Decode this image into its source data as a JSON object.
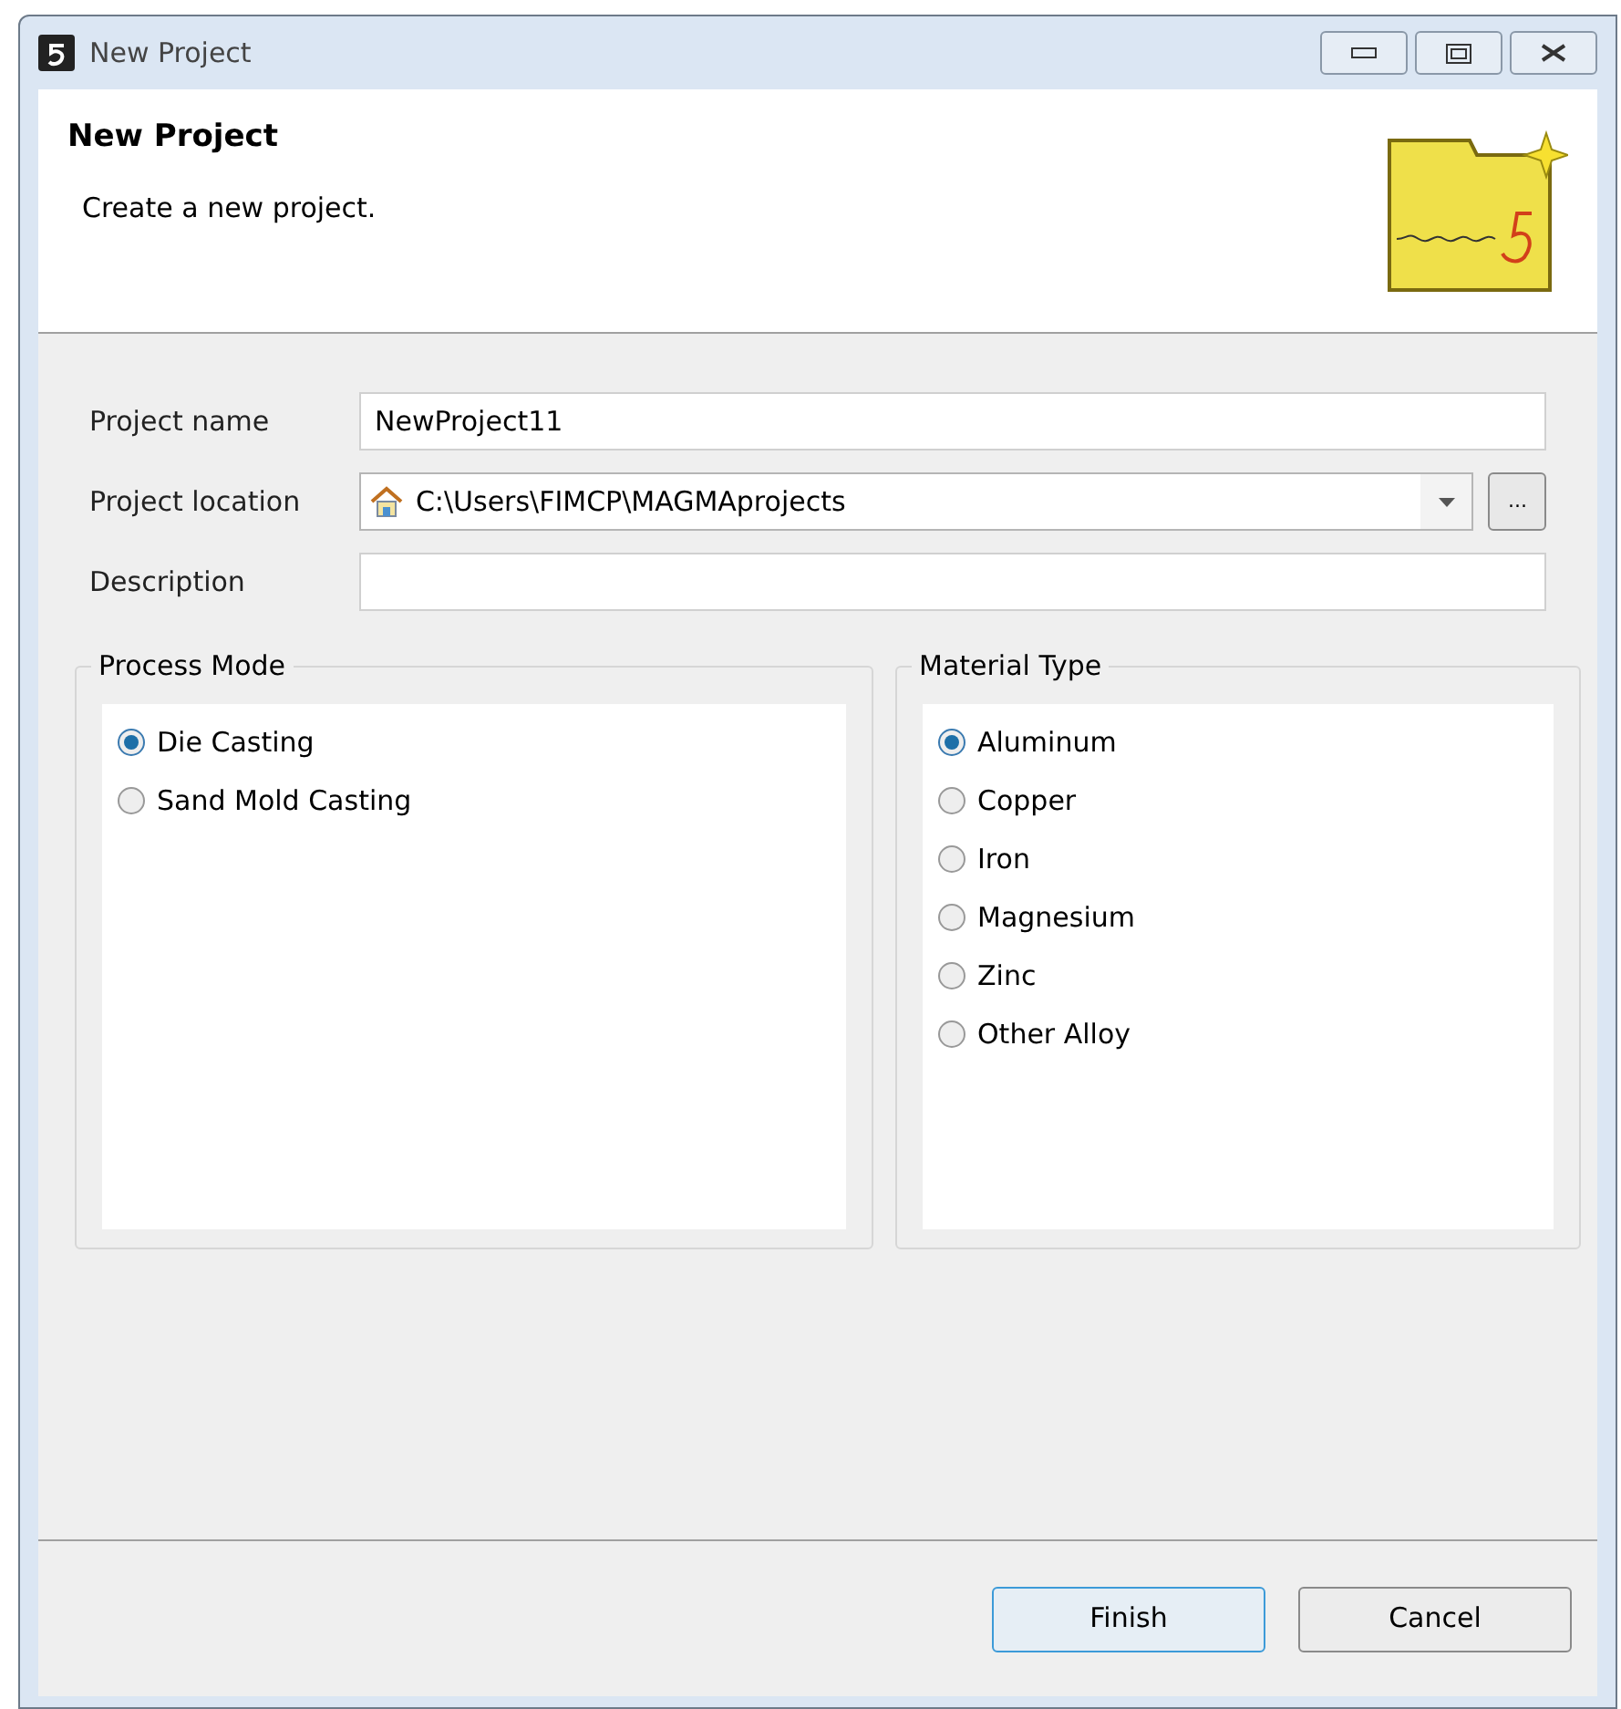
{
  "window": {
    "title": "New Project"
  },
  "header": {
    "title": "New Project",
    "description": "Create a new project."
  },
  "fields": [
    {
      "kind": "text",
      "label": "Project name",
      "value": "NewProject11"
    },
    {
      "kind": "combo",
      "label": "Project location",
      "value": "C:\\Users\\FIMCP\\MAGMAprojects",
      "browse": "..."
    },
    {
      "kind": "text",
      "label": "Description"
    }
  ],
  "groups": [
    {
      "title": "Process Mode",
      "options": [
        {
          "label": "Die Casting",
          "selected": true
        },
        {
          "label": "Sand Mold Casting",
          "selected": false
        }
      ]
    },
    {
      "title": "Material Type",
      "options": [
        {
          "label": "Aluminum",
          "selected": true
        },
        {
          "label": "Copper",
          "selected": false
        },
        {
          "label": "Iron",
          "selected": false
        },
        {
          "label": "Magnesium",
          "selected": false
        },
        {
          "label": "Zinc",
          "selected": false
        },
        {
          "label": "Other Alloy",
          "selected": false
        }
      ]
    }
  ],
  "buttons": [
    {
      "label": "Finish",
      "selected": true
    },
    {
      "label": "Cancel",
      "selected": false
    }
  ]
}
